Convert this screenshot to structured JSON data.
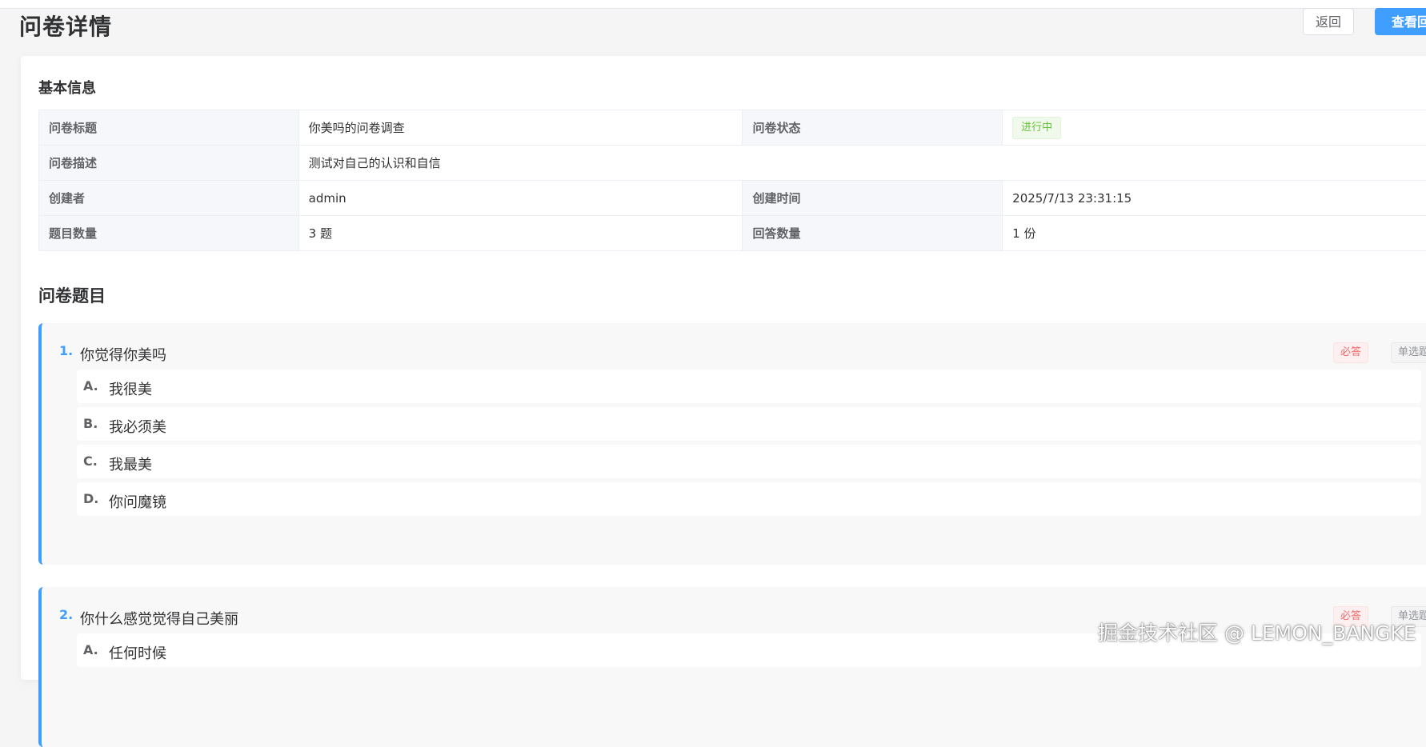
{
  "header": {
    "title": "问卷详情",
    "back_label": "返回",
    "primary_label": "查看回答"
  },
  "basic_info": {
    "section_title": "基本信息",
    "rows": [
      {
        "l1": "问卷标题",
        "v1": "你美吗的问卷调查",
        "l2": "问卷状态",
        "v2": "进行中"
      },
      {
        "l1": "问卷描述",
        "v1": "测试对自己的认识和自信"
      },
      {
        "l1": "创建者",
        "v1": "admin",
        "l2": "创建时间",
        "v2": "2025/7/13 23:31:15"
      },
      {
        "l1": "题目数量",
        "v1": "3 题",
        "l2": "回答数量",
        "v2": "1 份"
      }
    ]
  },
  "questions_section": {
    "title": "问卷题目",
    "questions": [
      {
        "num": "1.",
        "text": "你觉得你美吗",
        "required": "必答",
        "type": "单选题",
        "options": [
          {
            "key": "A.",
            "text": "我很美"
          },
          {
            "key": "B.",
            "text": "我必须美"
          },
          {
            "key": "C.",
            "text": "我最美"
          },
          {
            "key": "D.",
            "text": "你问魔镜"
          }
        ]
      },
      {
        "num": "2.",
        "text": "你什么感觉觉得自己美丽",
        "required": "必答",
        "type": "单选题",
        "options": [
          {
            "key": "A.",
            "text": "任何时候"
          }
        ]
      }
    ]
  },
  "watermark": "掘金技术社区 @ LEMON_BANGKE",
  "colors": {
    "primary": "#409eff",
    "status_green": "#67c23a",
    "required_red": "#f56c6c"
  }
}
